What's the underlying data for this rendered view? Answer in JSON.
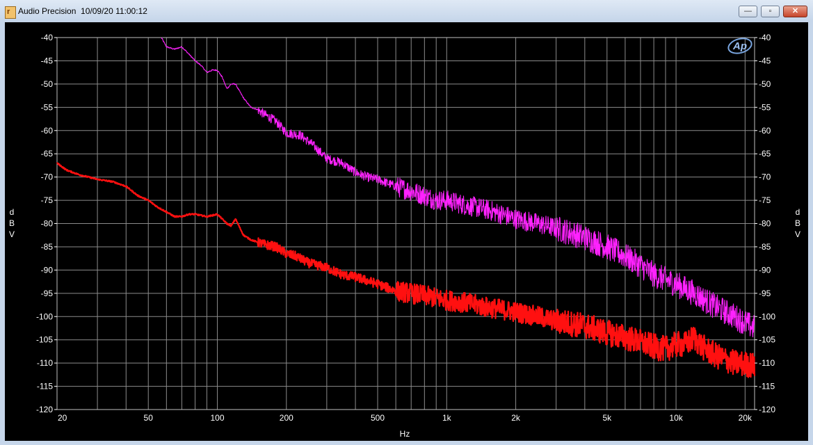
{
  "window": {
    "title": "Audio Precision  10/09/20 11:00:12",
    "minimize_label": "—",
    "maximize_label": "▫",
    "close_label": "✕"
  },
  "logo_text": "Ap",
  "colors": {
    "background": "#000000",
    "grid": "#8c8c8c",
    "axis_text": "#ffffff",
    "series_magenta": "#ff22ff",
    "series_red": "#ff1010"
  },
  "chart_data": {
    "type": "line",
    "title": "",
    "xlabel": "Hz",
    "ylabel": "dBV",
    "ylabel_letters": [
      "d",
      "B",
      "V"
    ],
    "xscale": "log",
    "xlim": [
      20,
      22000
    ],
    "ylim": [
      -120,
      -40
    ],
    "grid": true,
    "legend": "none",
    "yticks": [
      -40,
      -45,
      -50,
      -55,
      -60,
      -65,
      -70,
      -75,
      -80,
      -85,
      -90,
      -95,
      -100,
      -105,
      -110,
      -115,
      -120
    ],
    "xticks": [
      {
        "value": 20,
        "label": "20"
      },
      {
        "value": 50,
        "label": "50"
      },
      {
        "value": 100,
        "label": "100"
      },
      {
        "value": 200,
        "label": "200"
      },
      {
        "value": 500,
        "label": "500"
      },
      {
        "value": 1000,
        "label": "1k"
      },
      {
        "value": 2000,
        "label": "2k"
      },
      {
        "value": 5000,
        "label": "5k"
      },
      {
        "value": 10000,
        "label": "10k"
      },
      {
        "value": 20000,
        "label": "20k"
      }
    ],
    "series": [
      {
        "color": "#ff22ff",
        "x": [
          57,
          60,
          65,
          70,
          75,
          80,
          85,
          90,
          95,
          100,
          105,
          110,
          115,
          120,
          130,
          140,
          150,
          160,
          180,
          200,
          230,
          260,
          300,
          350,
          400,
          450,
          500,
          600,
          700,
          800,
          900,
          1000,
          1200,
          1500,
          2000,
          2500,
          3000,
          4000,
          5000,
          6000,
          7000,
          8000,
          10000,
          12000,
          15000,
          18000,
          22000
        ],
        "y": [
          -40,
          -42,
          -42.5,
          -42,
          -43.5,
          -45,
          -46,
          -47.5,
          -47,
          -47,
          -48.5,
          -51,
          -50,
          -50,
          -53,
          -55,
          -55.5,
          -56.5,
          -58,
          -60.5,
          -61,
          -63,
          -66,
          -67,
          -69,
          -70,
          -70.5,
          -72,
          -73,
          -74,
          -75,
          -75,
          -76,
          -77,
          -79,
          -80,
          -81,
          -83,
          -85,
          -87,
          -89,
          -91,
          -93,
          -95,
          -98,
          -100,
          -102.5
        ]
      },
      {
        "color": "#ff1010",
        "x": [
          20,
          22,
          25,
          30,
          35,
          40,
          45,
          50,
          55,
          60,
          65,
          70,
          75,
          80,
          90,
          100,
          110,
          115,
          120,
          130,
          140,
          160,
          180,
          200,
          220,
          250,
          300,
          350,
          400,
          500,
          600,
          700,
          800,
          1000,
          1200,
          1500,
          2000,
          2500,
          3000,
          4000,
          5000,
          6000,
          7000,
          8000,
          9000,
          10000,
          11000,
          12000,
          13000,
          15000,
          18000,
          22000
        ],
        "y": [
          -67,
          -68.5,
          -69.5,
          -70.5,
          -71,
          -72,
          -74,
          -75,
          -76.5,
          -77.5,
          -78.5,
          -78.5,
          -78,
          -78,
          -78.5,
          -78,
          -80,
          -80.5,
          -79,
          -82.5,
          -83.5,
          -84.5,
          -85,
          -86.5,
          -87,
          -88.5,
          -89.5,
          -91,
          -91.5,
          -93,
          -94.5,
          -95,
          -95.5,
          -96.5,
          -97,
          -98,
          -99,
          -100,
          -101,
          -102,
          -103.5,
          -104.5,
          -105.5,
          -106.5,
          -107,
          -106,
          -106,
          -104.5,
          -106.5,
          -108.5,
          -110,
          -110.5
        ]
      }
    ]
  }
}
